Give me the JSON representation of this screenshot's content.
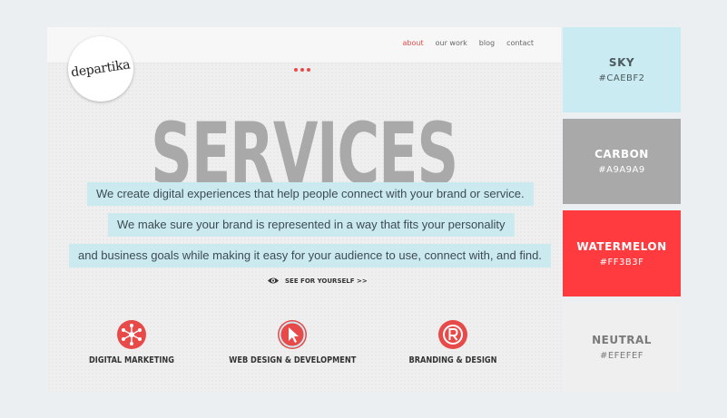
{
  "nav": {
    "items": [
      "about",
      "our work",
      "blog",
      "contact"
    ]
  },
  "logo": {
    "text": "departika"
  },
  "hero": {
    "title": "SERVICES",
    "lines": [
      "We create digital experiences that help people connect with your brand or service.",
      "We make sure your brand is represented in a way that fits your personality",
      "and business goals while making it easy for your audience to use, connect with, and find."
    ],
    "cta": "SEE FOR YOURSELF >>"
  },
  "services": [
    {
      "label": "DIGITAL MARKETING",
      "icon": "network-icon"
    },
    {
      "label": "WEB DESIGN & DEVELOPMENT",
      "icon": "cursor-icon"
    },
    {
      "label": "BRANDING & DESIGN",
      "icon": "registered-icon"
    }
  ],
  "palette": [
    {
      "name": "SKY",
      "hex": "#CAEBF2"
    },
    {
      "name": "CARBON",
      "hex": "#A9A9A9"
    },
    {
      "name": "WATERMELON",
      "hex": "#FF3B3F"
    },
    {
      "name": "NEUTRAL",
      "hex": "#EFEFEF"
    }
  ],
  "colors": {
    "accent": "#e84a4a",
    "sky": "#caebf2",
    "carbon": "#a9a9a9",
    "neutral": "#efefef"
  }
}
